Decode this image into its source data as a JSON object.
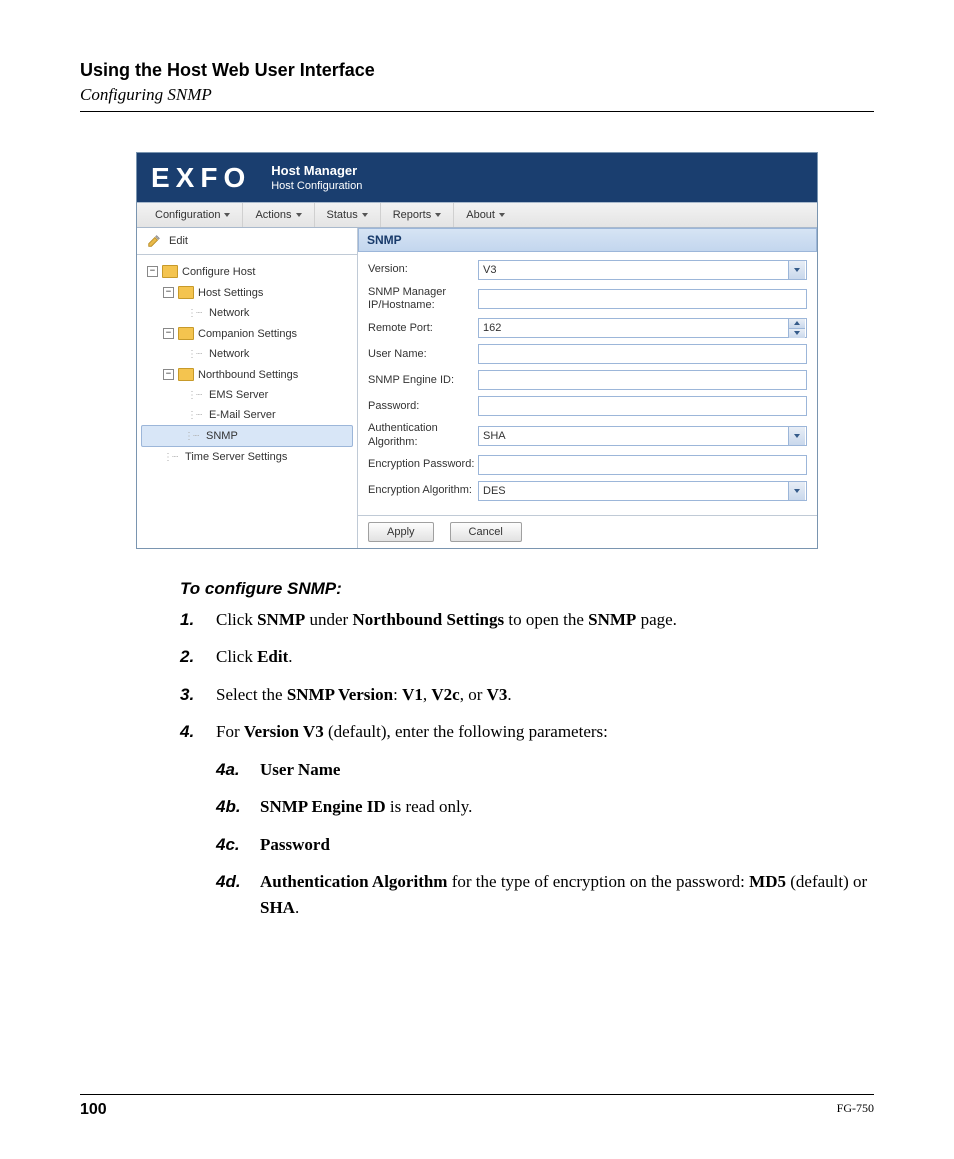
{
  "chapter": "Using the Host Web User Interface",
  "section": "Configuring SNMP",
  "screenshot": {
    "logo": "EXFO",
    "banner_title": "Host Manager",
    "banner_sub": "Host Configuration",
    "menu": [
      "Configuration",
      "Actions",
      "Status",
      "Reports",
      "About"
    ],
    "edit_label": "Edit",
    "tree": {
      "root": "Configure Host",
      "host_settings": "Host Settings",
      "host_network": "Network",
      "companion_settings": "Companion Settings",
      "companion_network": "Network",
      "northbound_settings": "Northbound Settings",
      "ems_server": "EMS Server",
      "email_server": "E-Mail Server",
      "snmp": "SNMP",
      "time_server": "Time Server Settings"
    },
    "form": {
      "title": "SNMP",
      "version_label": "Version:",
      "version_value": "V3",
      "mgr_label": "SNMP Manager IP/Hostname:",
      "mgr_value": "",
      "port_label": "Remote Port:",
      "port_value": "162",
      "user_label": "User Name:",
      "user_value": "",
      "engine_label": "SNMP Engine ID:",
      "engine_value": "",
      "pw_label": "Password:",
      "pw_value": "",
      "auth_label": "Authentication Algorithm:",
      "auth_value": "SHA",
      "encpw_label": "Encryption Password:",
      "encpw_value": "",
      "encalg_label": "Encryption Algorithm:",
      "encalg_value": "DES",
      "apply": "Apply",
      "cancel": "Cancel"
    }
  },
  "proc_title": "To configure SNMP:",
  "steps": {
    "s1_num": "1.",
    "s1a": "Click ",
    "s1b": "SNMP",
    "s1c": " under ",
    "s1d": "Northbound Settings",
    "s1e": " to open the ",
    "s1f": "SNMP",
    "s1g": " page.",
    "s2_num": "2.",
    "s2a": "Click ",
    "s2b": "Edit",
    "s2c": ".",
    "s3_num": "3.",
    "s3a": "Select the ",
    "s3b": "SNMP Version",
    "s3c": ": ",
    "s3d": "V1",
    "s3e": ", ",
    "s3f": "V2c",
    "s3g": ", or ",
    "s3h": "V3",
    "s3i": ".",
    "s4_num": "4.",
    "s4a": "For ",
    "s4b": "Version V3",
    "s4c": " (default), enter the following parameters:",
    "s4a_num": "4a.",
    "s4a_body": "User Name",
    "s4b_num": "4b.",
    "s4b_b1": "SNMP Engine ID",
    "s4b_b2": " is read only.",
    "s4c_num": "4c.",
    "s4c_body": "Password",
    "s4d_num": "4d.",
    "s4d_b1": "Authentication Algorithm",
    "s4d_b2": " for the type of encryption on the password: ",
    "s4d_b3": "MD5",
    "s4d_b4": " (default) or ",
    "s4d_b5": "SHA",
    "s4d_b6": "."
  },
  "footer": {
    "page": "100",
    "model": "FG-750"
  }
}
